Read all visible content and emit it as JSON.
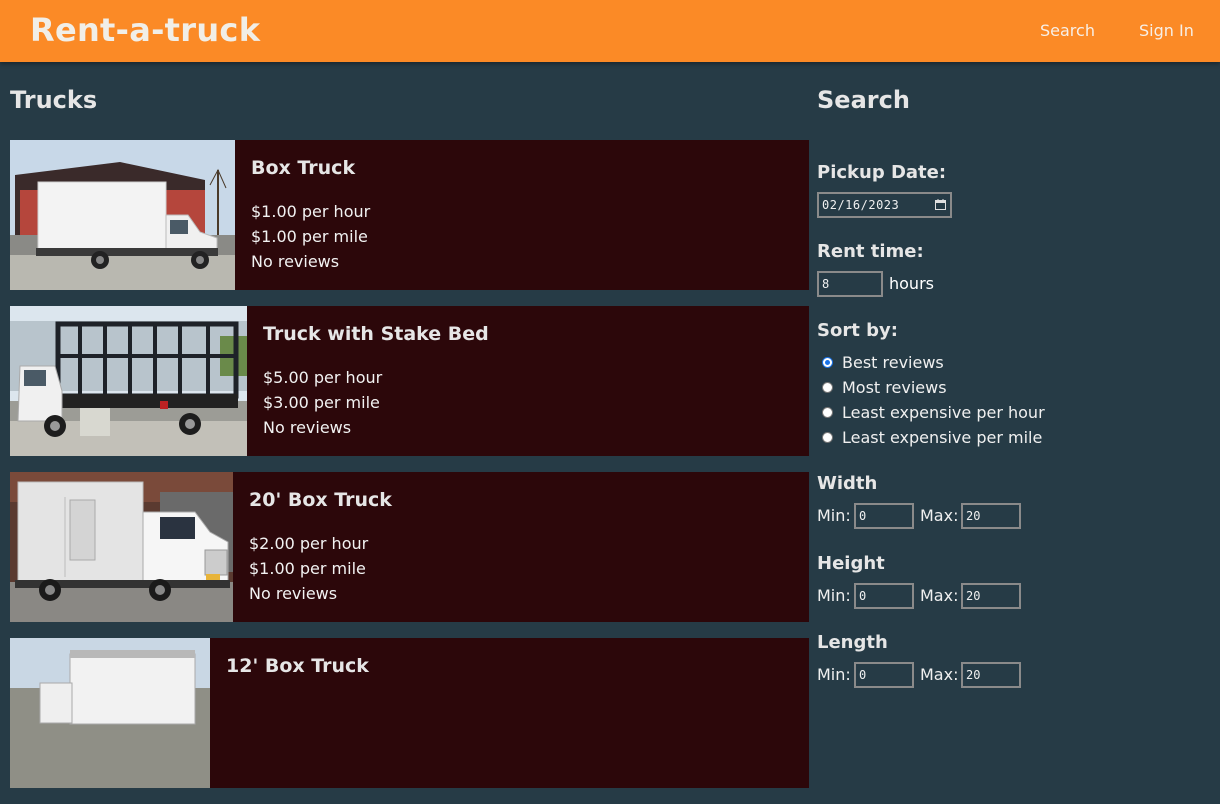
{
  "header": {
    "brand": "Rent-a-truck",
    "nav": {
      "search": "Search",
      "sign_in": "Sign In"
    }
  },
  "trucks_section": {
    "title": "Trucks",
    "items": [
      {
        "name": "Box Truck",
        "hourly": "$1.00 per hour",
        "mileage": "$1.00 per mile",
        "reviews": "No reviews"
      },
      {
        "name": "Truck with Stake Bed",
        "hourly": "$5.00 per hour",
        "mileage": "$3.00 per mile",
        "reviews": "No reviews"
      },
      {
        "name": "20' Box Truck",
        "hourly": "$2.00 per hour",
        "mileage": "$1.00 per mile",
        "reviews": "No reviews"
      },
      {
        "name": "12' Box Truck"
      }
    ]
  },
  "search_panel": {
    "title": "Search",
    "pickup_label": "Pickup Date:",
    "pickup_value": "02/16/2023",
    "rent_label": "Rent time:",
    "rent_value": "8",
    "rent_unit": "hours",
    "sort_label": "Sort by:",
    "sort_options": [
      {
        "label": "Best reviews",
        "selected": true
      },
      {
        "label": "Most reviews",
        "selected": false
      },
      {
        "label": "Least expensive per hour",
        "selected": false
      },
      {
        "label": "Least expensive per mile",
        "selected": false
      }
    ],
    "min_label": "Min:",
    "max_label": "Max:",
    "width": {
      "label": "Width",
      "min": "0",
      "max": "20"
    },
    "height": {
      "label": "Height",
      "min": "0",
      "max": "20"
    },
    "length": {
      "label": "Length",
      "min": "0",
      "max": "20"
    }
  },
  "colors": {
    "header_bg": "#fb8a26",
    "page_bg": "#263b46",
    "card_bg": "#2c070a",
    "radio_selected": "#1a73e8"
  }
}
